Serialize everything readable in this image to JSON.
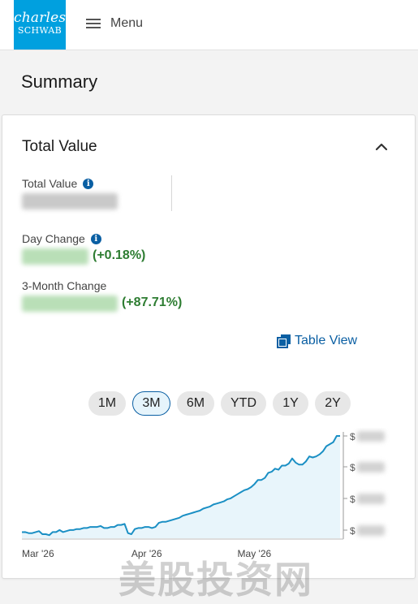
{
  "header": {
    "logo_line1": "charles",
    "logo_line2": "SCHWAB",
    "menu_label": "Menu",
    "menu_icon": "hamburger-icon"
  },
  "page": {
    "title": "Summary"
  },
  "card": {
    "title": "Total Value",
    "collapse_icon": "chevron-up-icon",
    "total_value": {
      "label": "Total Value",
      "value": ""
    },
    "day_change": {
      "label": "Day Change",
      "amount": "",
      "percent": "(+0.18%)"
    },
    "three_month_change": {
      "label": "3-Month Change",
      "amount": "",
      "percent": "(+87.71%)"
    },
    "table_view_label": "Table View",
    "table_view_icon": "copy-icon",
    "periods": [
      {
        "label": "1M",
        "active": false
      },
      {
        "label": "3M",
        "active": true
      },
      {
        "label": "6M",
        "active": false
      },
      {
        "label": "YTD",
        "active": false
      },
      {
        "label": "1Y",
        "active": false
      },
      {
        "label": "2Y",
        "active": false
      }
    ]
  },
  "colors": {
    "accent": "#0a5fa3",
    "positive": "#2e7d32",
    "brand": "#00a0df",
    "line": "#1a8fc4",
    "fill": "#e8f5fb"
  },
  "chart_data": {
    "type": "area",
    "x_labels": [
      "Mar '26",
      "Apr '26",
      "May '26"
    ],
    "y_labels": [
      "$",
      "$",
      "$",
      "$"
    ],
    "y_range": [
      0,
      100
    ],
    "values": [
      6,
      6,
      5,
      5,
      6,
      7,
      4,
      4,
      3,
      6,
      6,
      8,
      6,
      7,
      8,
      8,
      9,
      9,
      10,
      10,
      11,
      11,
      11,
      12,
      10,
      10,
      11,
      11,
      13,
      13,
      14,
      5,
      4,
      9,
      10,
      10,
      11,
      11,
      10,
      11,
      15,
      16,
      16,
      17,
      18,
      19,
      20,
      22,
      23,
      24,
      25,
      26,
      27,
      29,
      30,
      31,
      33,
      34,
      35,
      36,
      38,
      39,
      41,
      43,
      45,
      47,
      48,
      50,
      53,
      57,
      57,
      59,
      64,
      65,
      68,
      67,
      71,
      71,
      73,
      78,
      74,
      72,
      72,
      75,
      80,
      79,
      80,
      82,
      85,
      90,
      92,
      94,
      100,
      100
    ],
    "x_label_positions": [
      0,
      32,
      63
    ]
  },
  "watermark": "美股投资网"
}
